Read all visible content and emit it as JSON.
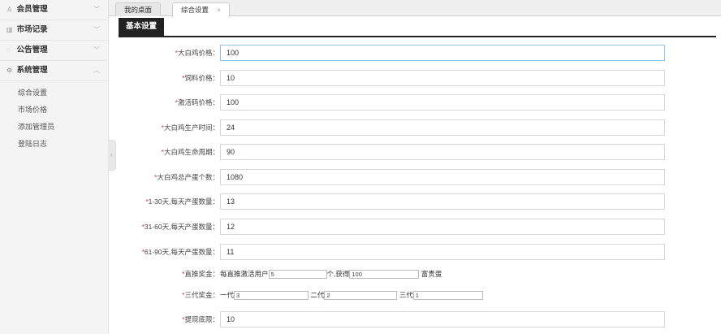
{
  "sidebar": {
    "groups": [
      {
        "icon": "user-icon",
        "label": "会员管理"
      },
      {
        "icon": "chart-icon",
        "label": "市场记录"
      },
      {
        "icon": "chat-icon",
        "label": "公告管理"
      },
      {
        "icon": "gear-icon",
        "label": "系统管理"
      }
    ],
    "sub_items": [
      "综合设置",
      "市场价格",
      "添加管理员",
      "登陆日志"
    ]
  },
  "tabs": [
    {
      "label": "我的桌面"
    },
    {
      "label": "综合设置",
      "close": "×"
    }
  ],
  "section": {
    "title": "基本设置"
  },
  "form": {
    "fields": [
      {
        "label": "大白鸡价格：",
        "value": "100"
      },
      {
        "label": "饲料价格：",
        "value": "10"
      },
      {
        "label": "激活码价格：",
        "value": "100"
      },
      {
        "label": "大白鸡生产时间：",
        "value": "24"
      },
      {
        "label": "大白鸡生命周期：",
        "value": "90"
      },
      {
        "label": "大白鸡总产蛋个数：",
        "value": "1080"
      },
      {
        "label": "1-30天,每天产蛋数量：",
        "value": "13"
      },
      {
        "label": "31-60天,每天产蛋数量：",
        "value": "12"
      },
      {
        "label": "61-90天,每天产蛋数量：",
        "value": "11"
      }
    ],
    "direct_bonus": {
      "label": "直推奖金：",
      "prefix": "每直推激活用户",
      "users": "5",
      "middle": "个,获得",
      "reward": "100",
      "suffix": "富贵蛋"
    },
    "tier_bonus": {
      "label": "三代奖金：",
      "gen1_label": "一代",
      "gen1": "3",
      "gen2_label": "二代",
      "gen2": "2",
      "gen3_label": "三代",
      "gen3": "1"
    },
    "withdraw_min": {
      "label": "提现底限：",
      "value": "10"
    },
    "required_mark": "*"
  }
}
